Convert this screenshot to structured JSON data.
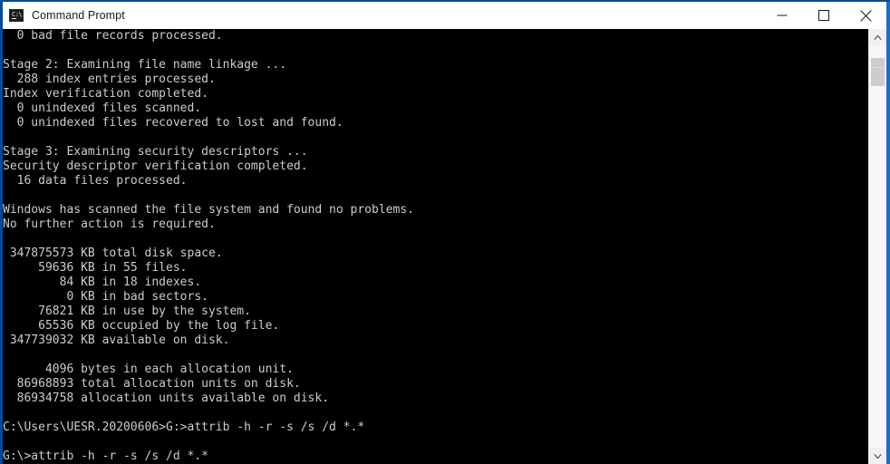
{
  "window": {
    "title": "Command Prompt",
    "app_icon": "command-prompt-icon",
    "accent_color": "#0a73d6",
    "border_color": "#0b4a8f",
    "console_background": "#000000",
    "console_foreground": "#cccccc"
  },
  "caption_buttons": [
    {
      "name": "minimize",
      "label": "Minimize",
      "glyph": "minimize-icon"
    },
    {
      "name": "maximize",
      "label": "Maximize",
      "glyph": "maximize-icon"
    },
    {
      "name": "close",
      "label": "Close",
      "glyph": "close-icon"
    }
  ],
  "console": {
    "lines": [
      "  0 bad file records processed.",
      "",
      "Stage 2: Examining file name linkage ...",
      "  288 index entries processed.",
      "Index verification completed.",
      "  0 unindexed files scanned.",
      "  0 unindexed files recovered to lost and found.",
      "",
      "Stage 3: Examining security descriptors ...",
      "Security descriptor verification completed.",
      "  16 data files processed.",
      "",
      "Windows has scanned the file system and found no problems.",
      "No further action is required.",
      "",
      " 347875573 KB total disk space.",
      "     59636 KB in 55 files.",
      "        84 KB in 18 indexes.",
      "         0 KB in bad sectors.",
      "     76821 KB in use by the system.",
      "     65536 KB occupied by the log file.",
      " 347739032 KB available on disk.",
      "",
      "      4096 bytes in each allocation unit.",
      "  86968893 total allocation units on disk.",
      "  86934758 allocation units available on disk.",
      "",
      "C:\\Users\\UESR.20200606>G:>attrib -h -r -s /s /d *.*",
      "",
      "G:\\>attrib -h -r -s /s /d *.*"
    ]
  },
  "scrollbar": {
    "up_arrow": "chevron-up-icon",
    "down_arrow": "chevron-down-icon",
    "thumb_position_percent": 3,
    "thumb_size_percent": 7
  }
}
